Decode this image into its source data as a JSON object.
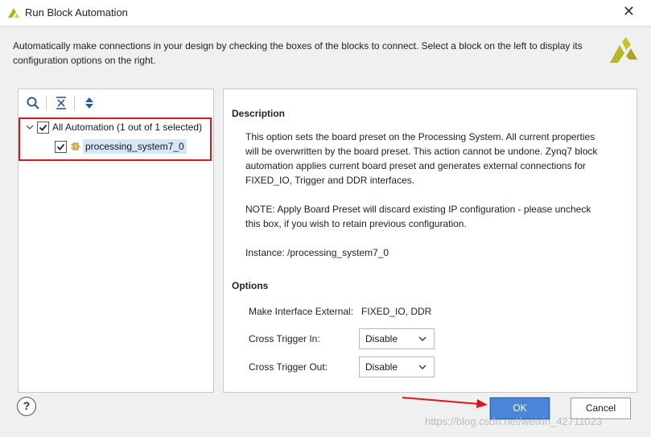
{
  "window": {
    "title": "Run Block Automation",
    "close_glyph": "✕"
  },
  "intro": {
    "line1": "Automatically make connections in your design by checking the boxes of the blocks to connect. Select a block on the left to display its",
    "line2": "configuration options on the right."
  },
  "tree": {
    "root_label": "All Automation (1 out of 1 selected)",
    "child_label": "processing_system7_0"
  },
  "description": {
    "header": "Description",
    "para1_line1": "This option sets the board preset on the Processing System. All current properties",
    "para1_line2": "will be overwritten by the board preset. This action cannot be undone. Zynq7 block",
    "para1_line3": "automation applies current board preset and generates external connections for",
    "para1_line4": "FIXED_IO, Trigger and DDR interfaces.",
    "para2_line1": "NOTE: Apply Board Preset will discard existing IP configuration - please uncheck",
    "para2_line2": "this box, if you wish to retain previous configuration.",
    "instance": "Instance: /processing_system7_0"
  },
  "options": {
    "header": "Options",
    "make_external_label": "Make Interface External:",
    "make_external_value": "FIXED_IO, DDR",
    "cross_trigger_in_label": "Cross Trigger In:",
    "cross_trigger_in_value": "Disable",
    "cross_trigger_out_label": "Cross Trigger Out:",
    "cross_trigger_out_value": "Disable"
  },
  "buttons": {
    "help": "?",
    "ok": "OK",
    "cancel": "Cancel"
  },
  "watermark": "https://blog.csdn.net/weixin_42711023",
  "colors": {
    "accent": "#4a86d8",
    "highlight_box": "#e0151b",
    "xilinx_logo": "#c4c022"
  }
}
